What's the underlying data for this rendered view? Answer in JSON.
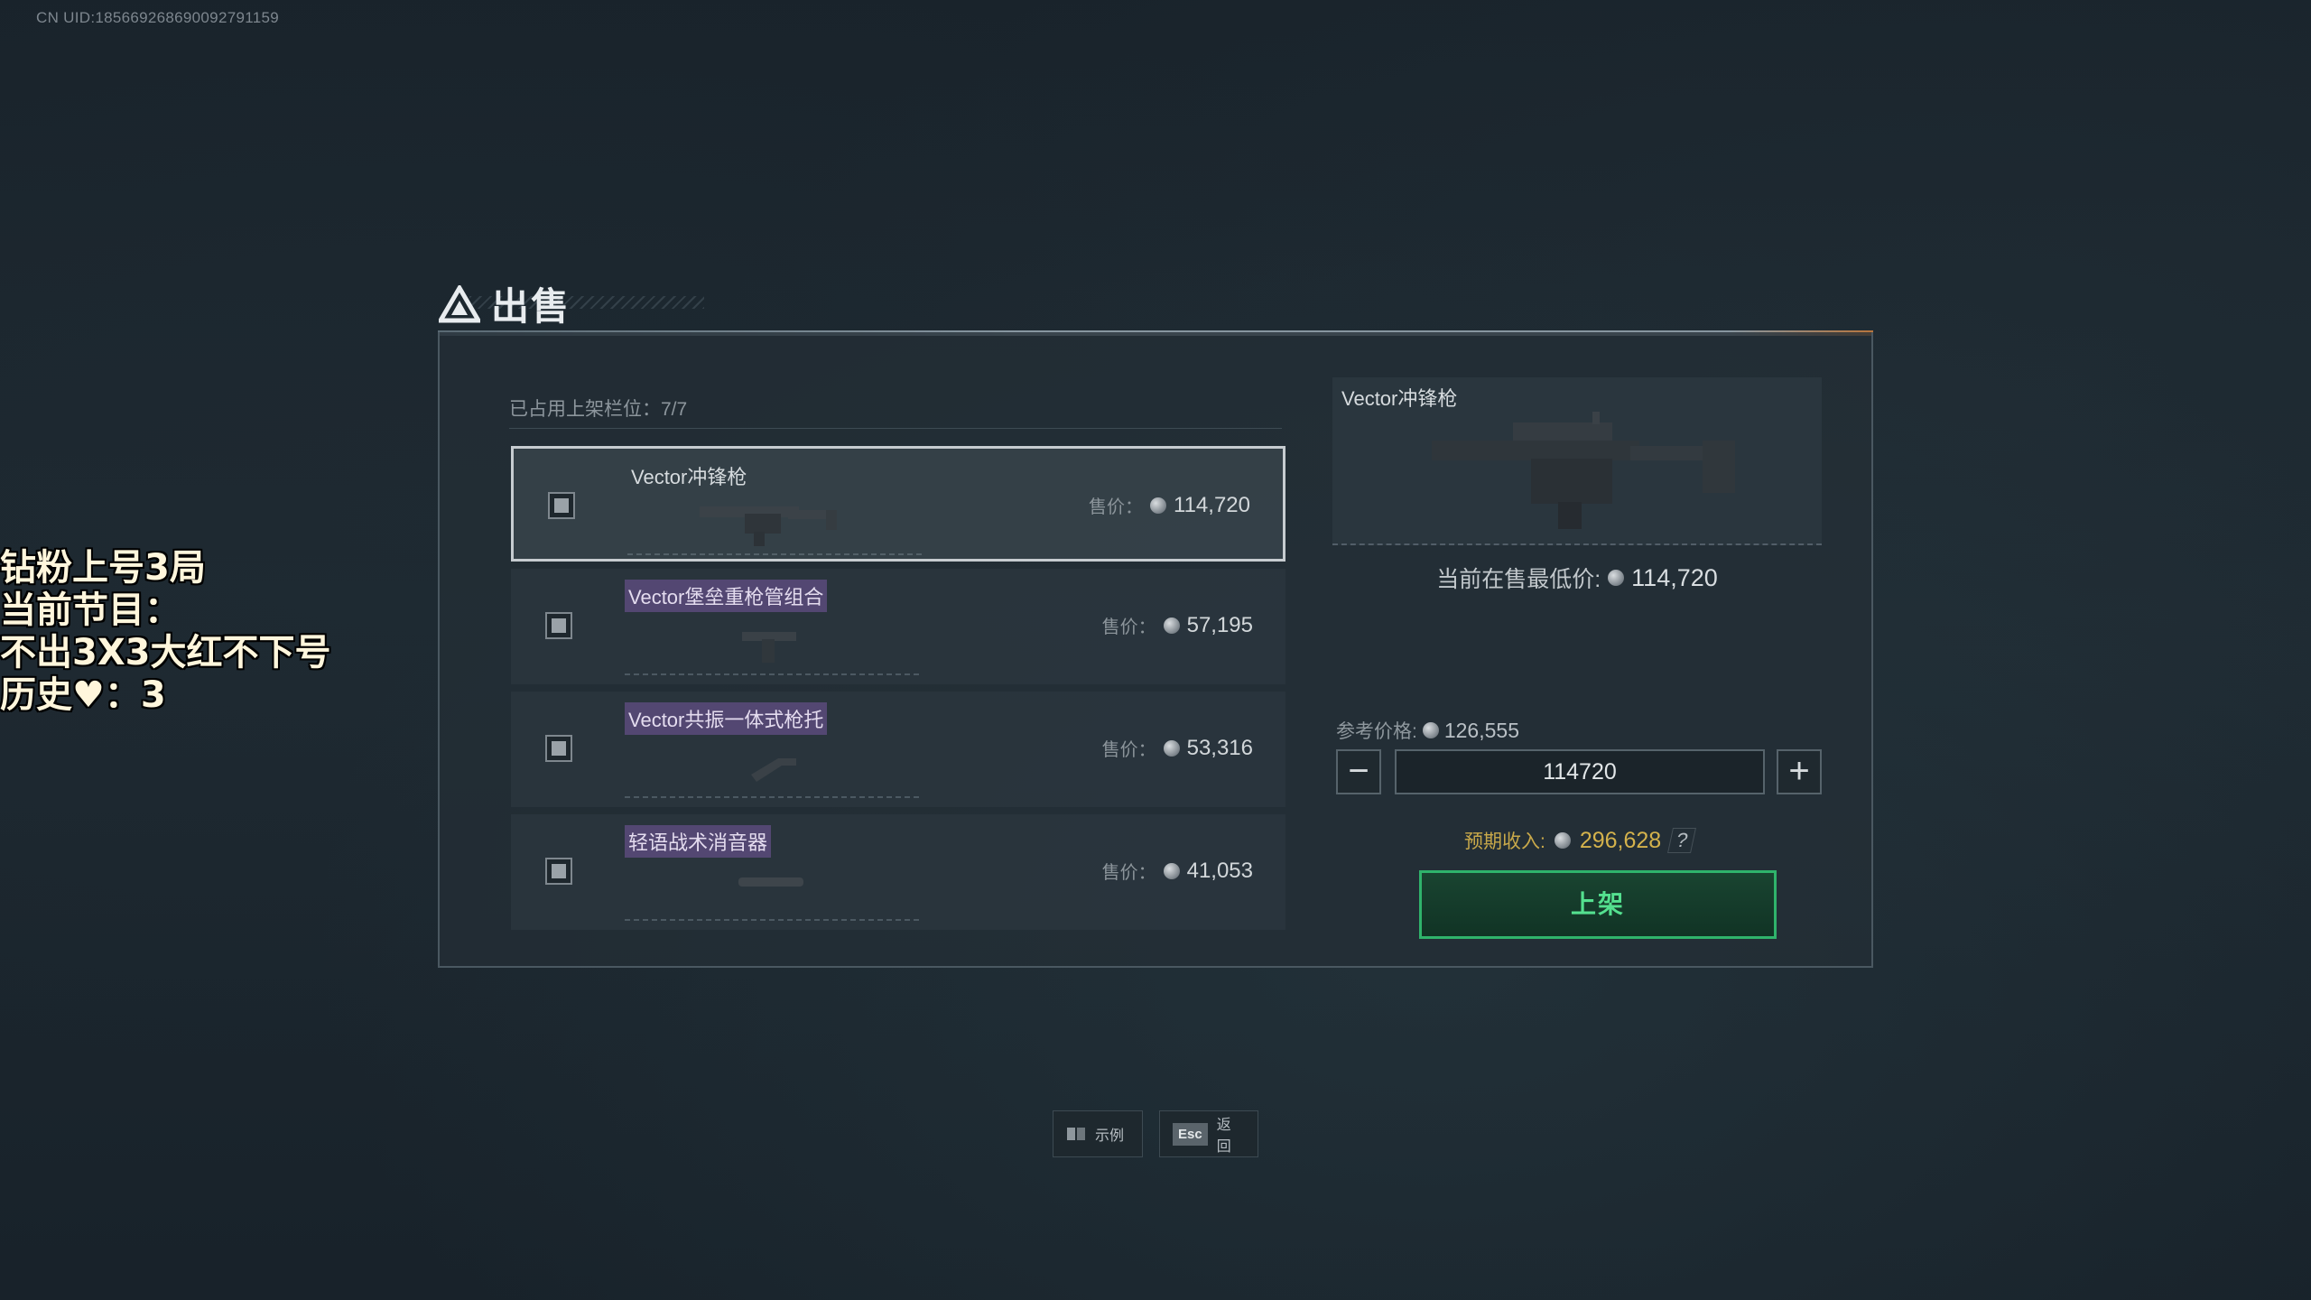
{
  "uid": "CN UID:18566926869009279115​9",
  "overlay": {
    "line1": "钻粉上号3局",
    "line2": "当前节目：",
    "line3": "不出3X3大红不下号",
    "line4_prefix": "历史",
    "line4_heart": "♥",
    "line4_suffix": "：3"
  },
  "title": "出售",
  "slots_label": "已占用上架栏位：7/7",
  "items": [
    {
      "name": "Vector冲锋枪",
      "price_label": "售价：",
      "price": "114,720",
      "icon": "smg-icon"
    },
    {
      "name": "Vector堡垒重枪管组合",
      "price_label": "售价：",
      "price": "57,195",
      "icon": "barrel-icon"
    },
    {
      "name": "Vector共振一体式枪托",
      "price_label": "售价：",
      "price": "53,316",
      "icon": "stock-icon"
    },
    {
      "name": "轻语战术消音器",
      "price_label": "售价：",
      "price": "41,053",
      "icon": "suppressor-icon"
    }
  ],
  "preview": {
    "name": "Vector冲锋枪",
    "lowest_label": "当前在售最低价:",
    "lowest_value": "114,720"
  },
  "pricing": {
    "ref_label": "参考价格:",
    "ref_value": "126,555",
    "input_value": "114720",
    "expected_label": "预期收入:",
    "expected_value": "296,628",
    "help": "?",
    "minus": "−",
    "plus": "+"
  },
  "list_button": "上架",
  "footer": {
    "example_label": "示例",
    "back_key": "Esc",
    "back_label": "返回"
  },
  "colors": {
    "accent_green": "#2fb36b",
    "income_gold": "#d4b24c",
    "tag_purple": "#624e84"
  }
}
